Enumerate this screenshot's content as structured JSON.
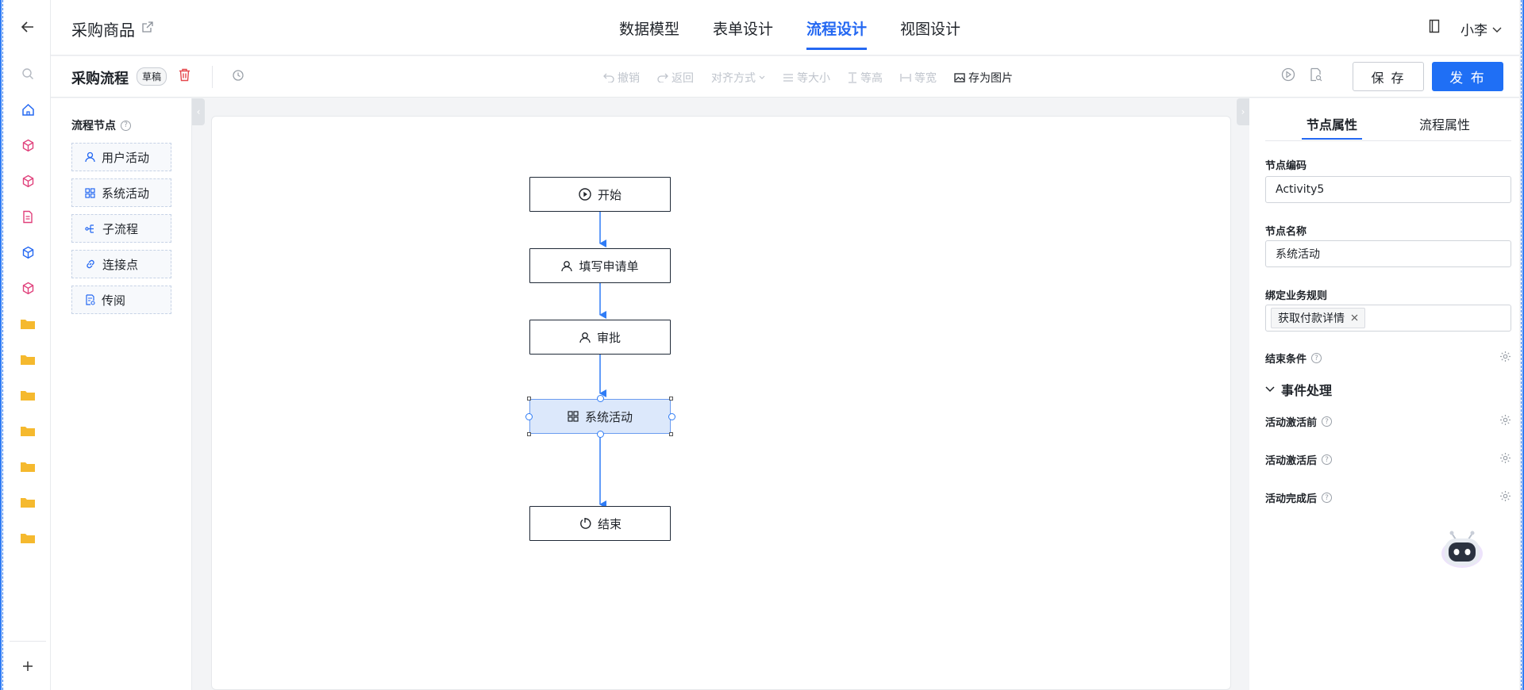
{
  "header": {
    "app_title": "采购商品",
    "tabs": [
      {
        "label": "数据模型",
        "active": false
      },
      {
        "label": "表单设计",
        "active": false
      },
      {
        "label": "流程设计",
        "active": true
      },
      {
        "label": "视图设计",
        "active": false
      }
    ],
    "user": "小李"
  },
  "toolbar": {
    "flow_name": "采购流程",
    "status_badge": "草稿",
    "tools": [
      "撤销",
      "返回",
      "对齐方式",
      "等大小",
      "等高",
      "等宽",
      "存为图片"
    ],
    "save_label": "保 存",
    "publish_label": "发 布"
  },
  "palette": {
    "title": "流程节点",
    "items": [
      "用户活动",
      "系统活动",
      "子流程",
      "连接点",
      "传阅"
    ]
  },
  "canvas": {
    "nodes": [
      {
        "label": "开始",
        "icon": "play-circle-icon"
      },
      {
        "label": "填写申请单",
        "icon": "user-icon"
      },
      {
        "label": "审批",
        "icon": "user-icon"
      },
      {
        "label": "系统活动",
        "icon": "grid-icon",
        "selected": true
      },
      {
        "label": "结束",
        "icon": "power-icon"
      }
    ]
  },
  "properties": {
    "tabs": [
      {
        "label": "节点属性",
        "active": true
      },
      {
        "label": "流程属性",
        "active": false
      }
    ],
    "node_code_label": "节点编码",
    "node_code_value": "Activity5",
    "node_name_label": "节点名称",
    "node_name_value": "系统活动",
    "rule_label": "绑定业务规则",
    "rule_tag": "获取付款详情",
    "end_condition_label": "结束条件",
    "event_section": "事件处理",
    "events": [
      "活动激活前",
      "活动激活后",
      "活动完成后"
    ]
  },
  "colors": {
    "accent": "#2468f2",
    "publish_button": "#1f6ff5",
    "selected_node": "#dce8fb",
    "delete_icon": "#e5484d"
  }
}
